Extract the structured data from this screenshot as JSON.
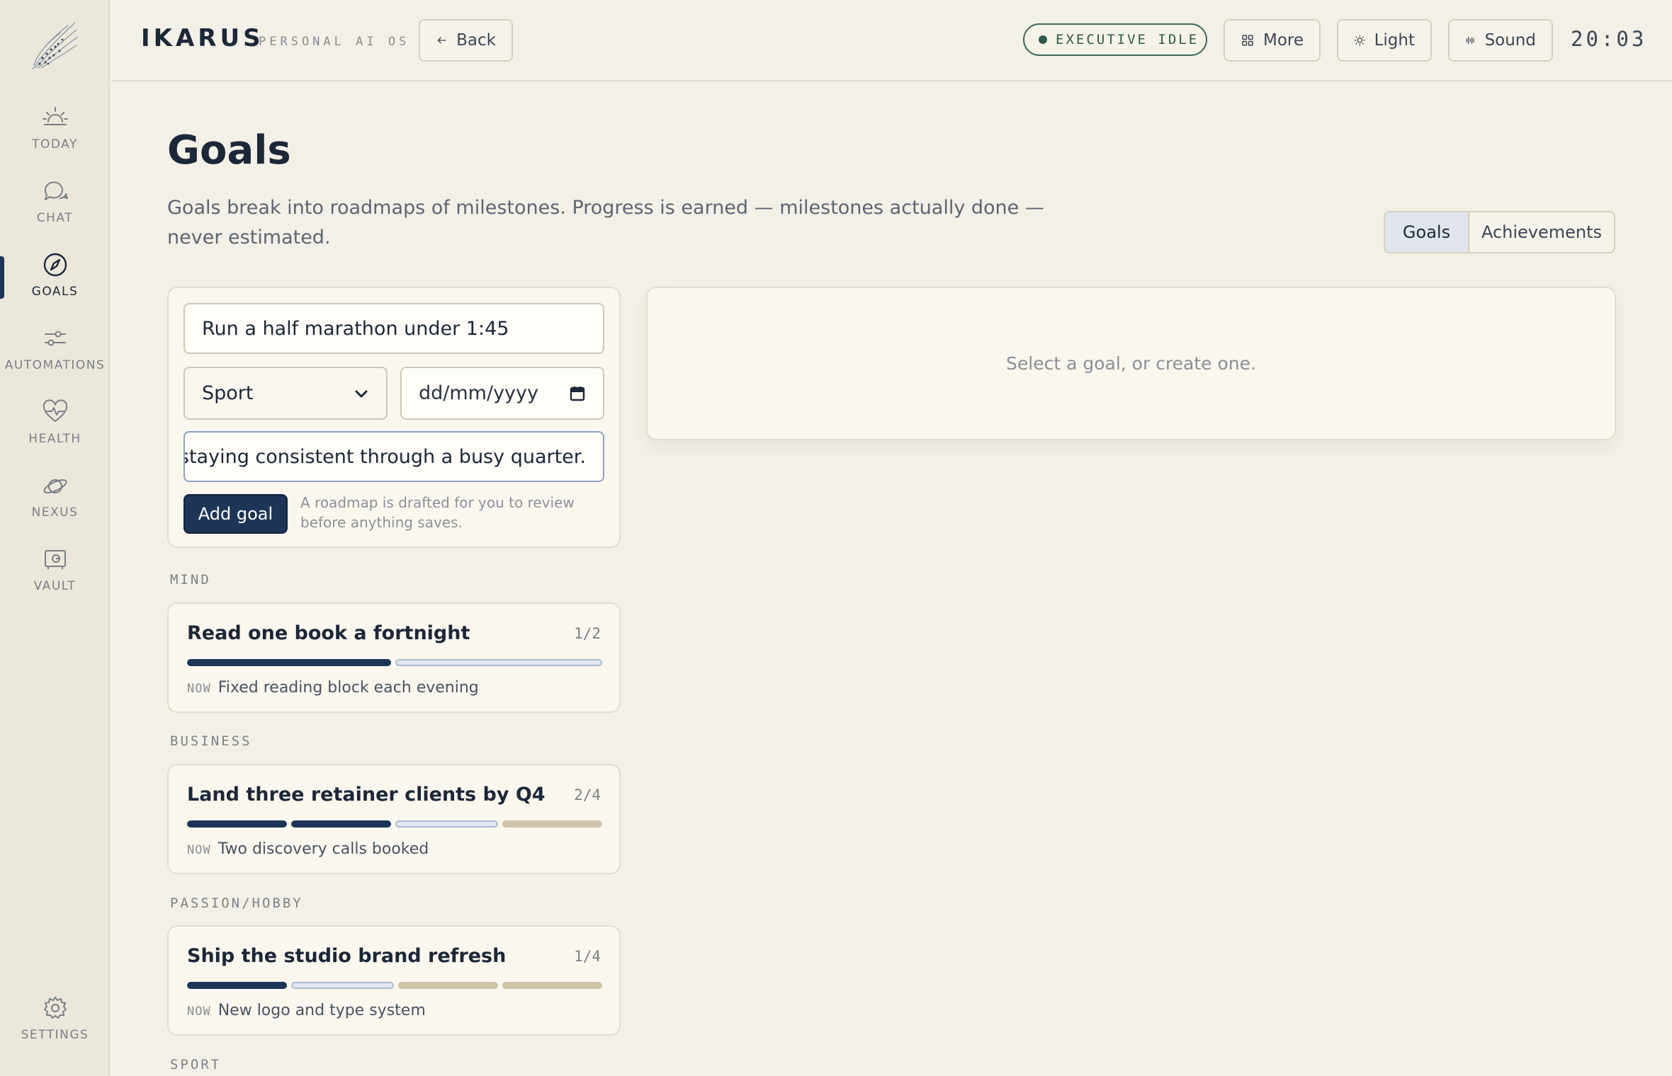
{
  "app": {
    "brand": "IKARUS",
    "brand_sub": "PERSONAL AI OS",
    "back_label": "Back",
    "status": "EXECUTIVE IDLE",
    "more_label": "More",
    "theme_label": "Light",
    "sound_label": "Sound",
    "clock": "20:03"
  },
  "sidebar": {
    "items": [
      {
        "label": "TODAY",
        "icon": "sunrise-icon"
      },
      {
        "label": "CHAT",
        "icon": "chat-bubbles-icon"
      },
      {
        "label": "GOALS",
        "icon": "compass-icon",
        "active": true
      },
      {
        "label": "AUTOMATIONS",
        "icon": "sliders-icon"
      },
      {
        "label": "HEALTH",
        "icon": "heart-pulse-icon"
      },
      {
        "label": "NEXUS",
        "icon": "planet-icon"
      },
      {
        "label": "VAULT",
        "icon": "vault-icon"
      }
    ],
    "settings_label": "SETTINGS"
  },
  "page": {
    "title": "Goals",
    "description": "Goals break into roadmaps of milestones. Progress is earned — milestones actually done — never estimated.",
    "tabs": [
      "Goals",
      "Achievements"
    ],
    "active_tab": "Goals"
  },
  "form": {
    "title_value": "Run a half marathon under 1:45",
    "category_value": "Sport",
    "date_placeholder": "dd/mm/yyyy",
    "note_value": "- for staying consistent through a busy quarter.",
    "add_label": "Add goal",
    "hint": "A roadmap is drafted for you to review before anything saves."
  },
  "detail": {
    "empty_text": "Select a goal, or create one."
  },
  "groups": [
    {
      "category": "MIND",
      "goal": {
        "title": "Read one book a fortnight",
        "count": "1/2",
        "milestones": [
          "done",
          "now"
        ],
        "now_tag": "NOW",
        "now_text": "Fixed reading block each evening"
      }
    },
    {
      "category": "BUSINESS",
      "goal": {
        "title": "Land three retainer clients by Q4",
        "count": "2/4",
        "milestones": [
          "done",
          "done",
          "now",
          "todo"
        ],
        "now_tag": "NOW",
        "now_text": "Two discovery calls booked"
      }
    },
    {
      "category": "PASSION/HOBBY",
      "goal": {
        "title": "Ship the studio brand refresh",
        "count": "1/4",
        "milestones": [
          "done",
          "now",
          "todo",
          "todo"
        ],
        "now_tag": "NOW",
        "now_text": "New logo and type system"
      }
    },
    {
      "category": "SPORT"
    }
  ],
  "colors": {
    "accent": "#1d3557",
    "background": "#f3f0e7",
    "status_green": "#2e5a4c"
  }
}
